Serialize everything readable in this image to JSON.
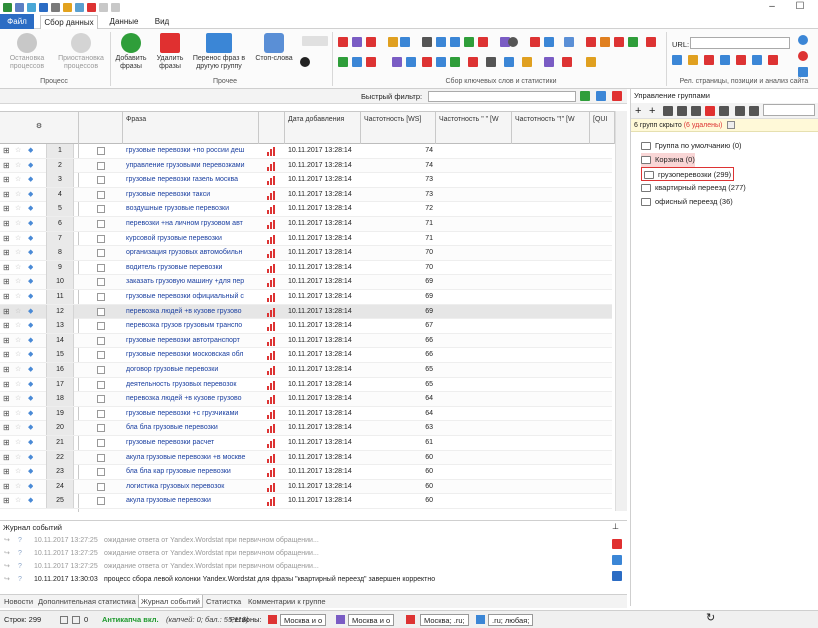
{
  "ribbon_tabs": {
    "file": "Файл",
    "collect": "Сбор данных",
    "data": "Данные",
    "view": "Вид"
  },
  "ribbon": {
    "stop_process": "Остановка процессов",
    "pause_process": "Приостановка процессов",
    "add_phrases": "Добавить фразы",
    "delete_phrases": "Удалить фразы",
    "move_phrases": "Перенос фраз в другую группу",
    "stop_words": "Стоп-слова",
    "group_process": "Процесс",
    "group_other": "Прочее",
    "group_collect": "Сбор ключевых слов и статистики",
    "group_rel": "Рел. страницы, позиции и анализ сайта",
    "url_label": "URL:"
  },
  "filter": {
    "label": "Быстрый фильтр:"
  },
  "columns": {
    "phrase": "Фраза",
    "date": "Дата добавления",
    "freq_ws": "Частотность [WS]",
    "freq_q": "Частотность \" \" [W",
    "freq_ex": "Частотность \"!\" [W",
    "qui": "[QUI"
  },
  "rows": [
    {
      "n": "1",
      "phrase": "грузовые перевозки +по россии деш",
      "date": "10.11.2017 13:28:14",
      "freq": "74"
    },
    {
      "n": "2",
      "phrase": "управление грузовыми перевозками",
      "date": "10.11.2017 13:28:14",
      "freq": "74"
    },
    {
      "n": "3",
      "phrase": "грузовые перевозки газель москва",
      "date": "10.11.2017 13:28:14",
      "freq": "73"
    },
    {
      "n": "4",
      "phrase": "грузовые перевозки такси",
      "date": "10.11.2017 13:28:14",
      "freq": "73"
    },
    {
      "n": "5",
      "phrase": "воздушные грузовые перевозки",
      "date": "10.11.2017 13:28:14",
      "freq": "72"
    },
    {
      "n": "6",
      "phrase": "перевозки +на личном грузовом авт",
      "date": "10.11.2017 13:28:14",
      "freq": "71"
    },
    {
      "n": "7",
      "phrase": "курсовой грузовые перевозки",
      "date": "10.11.2017 13:28:14",
      "freq": "71"
    },
    {
      "n": "8",
      "phrase": "организация грузовых автомобильн",
      "date": "10.11.2017 13:28:14",
      "freq": "70"
    },
    {
      "n": "9",
      "phrase": "водитель грузовые перевозки",
      "date": "10.11.2017 13:28:14",
      "freq": "70"
    },
    {
      "n": "10",
      "phrase": "заказать грузовую машину +для пер",
      "date": "10.11.2017 13:28:14",
      "freq": "69"
    },
    {
      "n": "11",
      "phrase": "грузовые перевозки официальный с",
      "date": "10.11.2017 13:28:14",
      "freq": "69"
    },
    {
      "n": "12",
      "phrase": "перевозка людей +в кузове грузово",
      "date": "10.11.2017 13:28:14",
      "freq": "69"
    },
    {
      "n": "13",
      "phrase": "перевозка грузов грузовым транспо",
      "date": "10.11.2017 13:28:14",
      "freq": "67"
    },
    {
      "n": "14",
      "phrase": "грузовые перевозки автотранспорт",
      "date": "10.11.2017 13:28:14",
      "freq": "66"
    },
    {
      "n": "15",
      "phrase": "грузовые перевозки московская обл",
      "date": "10.11.2017 13:28:14",
      "freq": "66"
    },
    {
      "n": "16",
      "phrase": "договор грузовые перевозки",
      "date": "10.11.2017 13:28:14",
      "freq": "65"
    },
    {
      "n": "17",
      "phrase": "деятельность грузовых перевозок",
      "date": "10.11.2017 13:28:14",
      "freq": "65"
    },
    {
      "n": "18",
      "phrase": "перевозка людей +в кузове грузово",
      "date": "10.11.2017 13:28:14",
      "freq": "64"
    },
    {
      "n": "19",
      "phrase": "грузовые перевозки +с грузчиками",
      "date": "10.11.2017 13:28:14",
      "freq": "64"
    },
    {
      "n": "20",
      "phrase": "бла бла грузовые перевозки",
      "date": "10.11.2017 13:28:14",
      "freq": "63"
    },
    {
      "n": "21",
      "phrase": "грузовые перевозки расчет",
      "date": "10.11.2017 13:28:14",
      "freq": "61"
    },
    {
      "n": "22",
      "phrase": "акула грузовые перевозки +в москве",
      "date": "10.11.2017 13:28:14",
      "freq": "60"
    },
    {
      "n": "23",
      "phrase": "бла бла кар грузовые перевозки",
      "date": "10.11.2017 13:28:14",
      "freq": "60"
    },
    {
      "n": "24",
      "phrase": "логистика грузовых перевозок",
      "date": "10.11.2017 13:28:14",
      "freq": "60"
    },
    {
      "n": "25",
      "phrase": "акула грузовые перевозки",
      "date": "10.11.2017 13:28:14",
      "freq": "60"
    }
  ],
  "groups": {
    "title": "Управление группами",
    "hidden_a": "6 групп скрыто",
    "hidden_b": "(6 удалены)",
    "items": [
      {
        "label": "Группа по умолчанию (0)"
      },
      {
        "label": "Корзина (0)"
      },
      {
        "label": "грузоперевозки (299)"
      },
      {
        "label": "квартирный переезд (277)"
      },
      {
        "label": "офисный переезд (36)"
      }
    ]
  },
  "log": {
    "title": "Журнал событий",
    "rows": [
      {
        "time": "10.11.2017 13:27:25",
        "text": "ожидание ответа от Yandex.Wordstat при первичном обращении..."
      },
      {
        "time": "10.11.2017 13:27:25",
        "text": "ожидание ответа от Yandex.Wordstat при первичном обращении..."
      },
      {
        "time": "10.11.2017 13:27:25",
        "text": "ожидание ответа от Yandex.Wordstat при первичном обращении..."
      },
      {
        "time": "10.11.2017 13:30:03",
        "text": "процесс сбора левой колонки Yandex.Wordstat для фразы \"квартирный переезд\" завершен корректно"
      }
    ]
  },
  "bottom_tabs": [
    "Новости",
    "Дополнительная статистика",
    "Журнал событий",
    "Статистка",
    "Комментарии к группе"
  ],
  "status": {
    "rows": "Строк: 299",
    "zero": "0",
    "anticaptcha": "Антикапча вкл.",
    "balance": "(капчей: 0; бал.: 55,11$)",
    "regions": "Регионы:",
    "r1": "Москва и о",
    "r2": "Москва и о",
    "r3": "Москва; .ru;",
    "r4": ".ru; любая;"
  },
  "colors": {
    "accent": "#2b6cc4",
    "phrase": "#1a3fa0",
    "green": "#1e9a2e",
    "red": "#d33"
  }
}
